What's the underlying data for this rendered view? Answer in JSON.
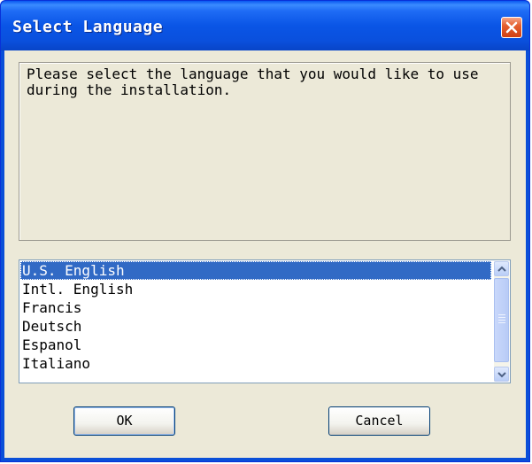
{
  "window": {
    "title": "Select Language"
  },
  "message": {
    "text": "Please select the language that you would like to use during the installation."
  },
  "language_list": {
    "items": [
      {
        "label": "U.S. English",
        "selected": true
      },
      {
        "label": "Intl. English",
        "selected": false
      },
      {
        "label": "Francis",
        "selected": false
      },
      {
        "label": "Deutsch",
        "selected": false
      },
      {
        "label": "Espanol",
        "selected": false
      },
      {
        "label": "Italiano",
        "selected": false
      }
    ]
  },
  "buttons": {
    "ok_label": "OK",
    "cancel_label": "Cancel"
  },
  "icons": {
    "close": "close-icon",
    "scroll_up": "chevron-up-icon",
    "scroll_down": "chevron-down-icon"
  },
  "colors": {
    "titlebar": "#0a55e6",
    "dialog_background": "#ece9d8",
    "selection": "#316ac5",
    "close_button": "#e5602f"
  }
}
